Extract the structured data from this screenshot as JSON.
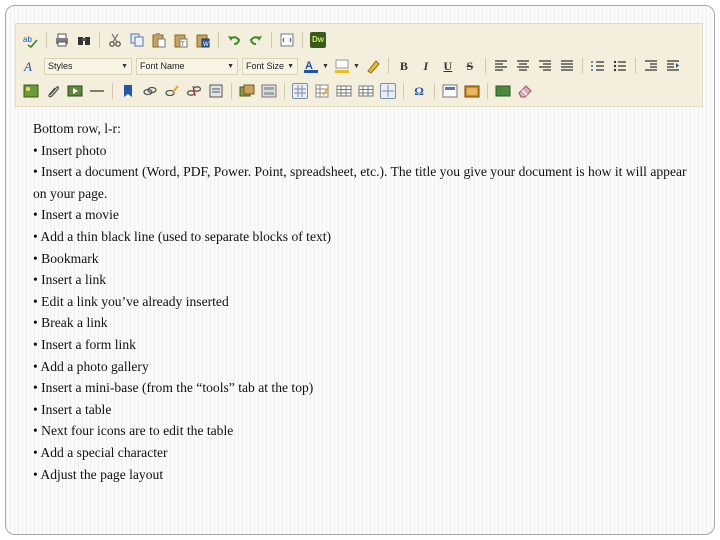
{
  "toolbar": {
    "styles_label": "Styles",
    "font_name_label": "Font Name",
    "font_size_label": "Font Size",
    "dw_label": "Dw",
    "bold_label": "B",
    "italic_label": "I",
    "underline_label": "U",
    "strike_label": "S",
    "special_char_label": "Ω",
    "accent_color": "#f3efdc"
  },
  "content": {
    "heading": "Bottom row, l-r:",
    "items": [
      "• Insert photo",
      "• Insert a document (Word, PDF, Power. Point, spreadsheet, etc.). The title you give your document is how it will appear on your page.",
      "• Insert a movie",
      "• Add a thin black line (used to separate blocks of text)",
      "• Bookmark",
      "• Insert a link",
      "• Edit a link you’ve already inserted",
      "• Break a link",
      "• Insert a form link",
      "• Add a photo gallery",
      "• Insert a mini-base (from the “tools” tab at the top)",
      "• Insert a table",
      "• Next four icons are to edit the table",
      "• Add a special character",
      "• Adjust the page layout"
    ]
  }
}
